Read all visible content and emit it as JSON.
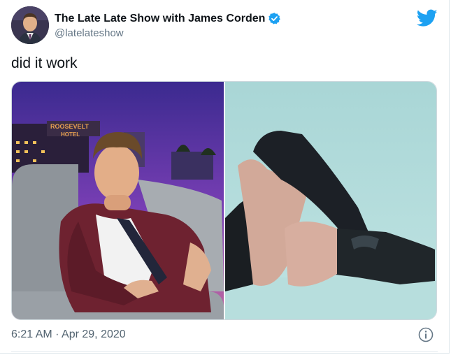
{
  "tweet": {
    "display_name": "The Late Late Show with James Corden",
    "handle": "@latelateshow",
    "text": "did it work",
    "timestamp": "6:21 AM · Apr 29, 2020"
  },
  "media": {
    "left_sign_line1": "ROOSEVELT",
    "left_sign_line2": "HOTEL"
  },
  "icons": {
    "verified": "verified-badge-icon",
    "brand": "twitter-bird-icon",
    "info": "info-icon"
  },
  "colors": {
    "twitter_blue": "#1da1f2",
    "text_primary": "#0f1419",
    "text_secondary": "#657786"
  }
}
